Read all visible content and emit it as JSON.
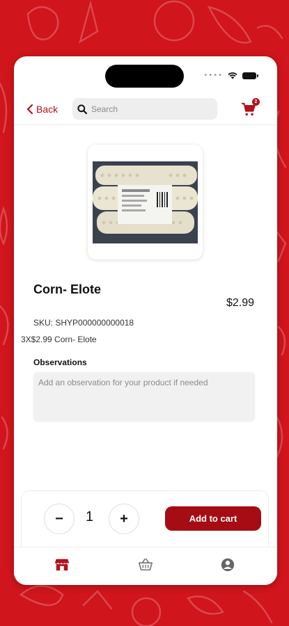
{
  "header": {
    "back_label": "Back",
    "search_placeholder": "Search",
    "cart_count": "2"
  },
  "product": {
    "name": "Corn- Elote",
    "price": "$2.99",
    "sku": "SKU: SHYP000000000018",
    "promo": "3X$2.99 Corn- Elote"
  },
  "observations": {
    "label": "Observations",
    "placeholder": "Add an observation for your product if needed"
  },
  "cart_controls": {
    "minus": "−",
    "plus": "+",
    "quantity": "1",
    "add_label": "Add to cart"
  },
  "tabs": [
    {
      "icon": "store-icon"
    },
    {
      "icon": "basket-icon"
    },
    {
      "icon": "profile-icon"
    }
  ],
  "colors": {
    "brand_red": "#d0151c",
    "accent_red": "#b3121b",
    "button_red": "#a50c14"
  }
}
